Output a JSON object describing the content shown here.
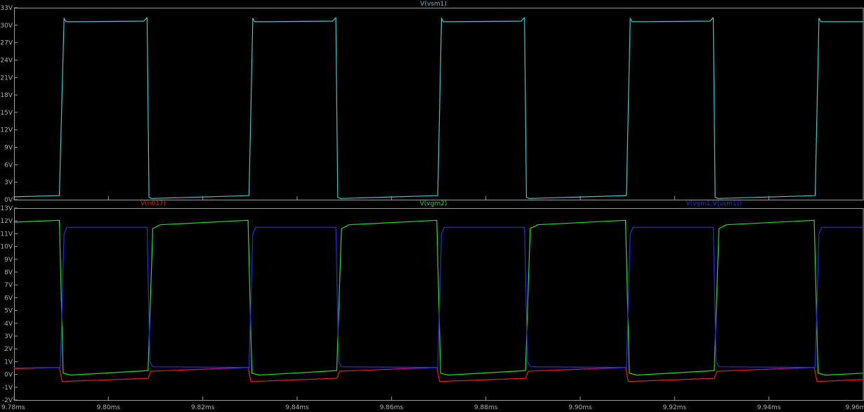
{
  "chart_data": [
    {
      "type": "line",
      "x_unit": "ms",
      "y_unit": "V",
      "xlim": [
        9.78,
        9.96
      ],
      "ylim": [
        0,
        33
      ],
      "xticks": [
        "9.78ms",
        "9.80ms",
        "9.82ms",
        "9.84ms",
        "9.86ms",
        "9.88ms",
        "9.90ms",
        "9.92ms",
        "9.94ms",
        "9.96ms"
      ],
      "yticks": [
        "0V",
        "3V",
        "6V",
        "9V",
        "12V",
        "15V",
        "18V",
        "21V",
        "24V",
        "27V",
        "30V",
        "33V"
      ],
      "grid": false,
      "legend": "top-center",
      "series": [
        {
          "name": "V(vsm1)",
          "color": "#3fc7c7",
          "x": [
            9.78,
            9.7896,
            9.7906,
            9.791,
            9.7935,
            9.8075,
            9.8082,
            9.8086,
            9.8092,
            9.8298,
            9.8306,
            9.831,
            9.8335,
            9.8475,
            9.8482,
            9.8486,
            9.8492,
            9.8698,
            9.8706,
            9.871,
            9.8735,
            9.8875,
            9.8882,
            9.8886,
            9.8892,
            9.9098,
            9.9106,
            9.911,
            9.9135,
            9.9275,
            9.9282,
            9.9286,
            9.9292,
            9.9498,
            9.9506,
            9.951,
            9.9535,
            9.96
          ],
          "y": [
            0.5,
            0.7,
            31.2,
            30.6,
            30.6,
            30.7,
            31.3,
            0.4,
            0.2,
            0.7,
            31.2,
            30.6,
            30.6,
            30.7,
            31.3,
            0.4,
            0.2,
            0.7,
            31.2,
            30.6,
            30.6,
            30.7,
            31.3,
            0.4,
            0.2,
            0.7,
            31.2,
            30.6,
            30.6,
            30.7,
            31.3,
            0.4,
            0.2,
            0.7,
            31.2,
            30.6,
            30.6,
            30.6
          ]
        }
      ]
    },
    {
      "type": "line",
      "x_unit": "ms",
      "y_unit": "V",
      "xlim": [
        9.78,
        9.96
      ],
      "ylim": [
        -2,
        13
      ],
      "xticks": [
        "9.78ms",
        "9.80ms",
        "9.82ms",
        "9.84ms",
        "9.86ms",
        "9.88ms",
        "9.90ms",
        "9.92ms",
        "9.94ms",
        "9.96ms"
      ],
      "yticks": [
        "-2V",
        "-1V",
        "0V",
        "1V",
        "2V",
        "3V",
        "4V",
        "5V",
        "6V",
        "7V",
        "8V",
        "9V",
        "10V",
        "11V",
        "12V",
        "13V"
      ],
      "grid": false,
      "legend": "top",
      "series": [
        {
          "name": "V(n017)",
          "color": "#e02020",
          "x": [
            9.78,
            9.7896,
            9.7902,
            9.8084,
            9.809,
            9.8296,
            9.8302,
            9.8484,
            9.849,
            9.8696,
            9.8702,
            9.8884,
            9.889,
            9.9096,
            9.9102,
            9.9284,
            9.929,
            9.9496,
            9.9502,
            9.96
          ],
          "y": [
            0.45,
            0.55,
            -0.55,
            -0.3,
            0.25,
            0.55,
            -0.55,
            -0.3,
            0.25,
            0.55,
            -0.55,
            -0.3,
            0.25,
            0.55,
            -0.55,
            -0.3,
            0.25,
            0.55,
            -0.55,
            -0.4
          ]
        },
        {
          "name": "V(vgm2)",
          "color": "#22dd22",
          "x": [
            9.78,
            9.7896,
            9.7904,
            9.792,
            9.8084,
            9.8094,
            9.811,
            9.8296,
            9.8304,
            9.832,
            9.8484,
            9.8494,
            9.851,
            9.8696,
            9.8704,
            9.872,
            9.8884,
            9.8894,
            9.891,
            9.9096,
            9.9104,
            9.912,
            9.9284,
            9.9294,
            9.931,
            9.9496,
            9.9504,
            9.952,
            9.96
          ],
          "y": [
            11.9,
            12.05,
            0.1,
            -0.05,
            0.3,
            11.4,
            11.7,
            12.05,
            0.1,
            -0.05,
            0.3,
            11.4,
            11.7,
            12.05,
            0.1,
            -0.05,
            0.3,
            11.4,
            11.7,
            12.05,
            0.1,
            -0.05,
            0.3,
            11.4,
            11.7,
            12.05,
            0.1,
            -0.05,
            0.1
          ]
        },
        {
          "name": "V(vgm1,V(vsm1))",
          "color": "#2a2ae0",
          "x": [
            9.78,
            9.7898,
            9.7906,
            9.7912,
            9.8082,
            9.8088,
            9.8094,
            9.8298,
            9.8306,
            9.8312,
            9.8482,
            9.8488,
            9.8494,
            9.8698,
            9.8706,
            9.8712,
            9.8882,
            9.8888,
            9.8894,
            9.9098,
            9.9106,
            9.9112,
            9.9282,
            9.9288,
            9.9294,
            9.9498,
            9.9506,
            9.9512,
            9.96
          ],
          "y": [
            0.5,
            0.55,
            11.0,
            11.5,
            11.5,
            1.0,
            0.6,
            0.55,
            11.0,
            11.5,
            11.5,
            1.0,
            0.6,
            0.55,
            11.0,
            11.5,
            11.5,
            1.0,
            0.6,
            0.55,
            11.0,
            11.5,
            11.5,
            1.0,
            0.6,
            0.55,
            11.0,
            11.5,
            11.5
          ]
        }
      ]
    }
  ]
}
